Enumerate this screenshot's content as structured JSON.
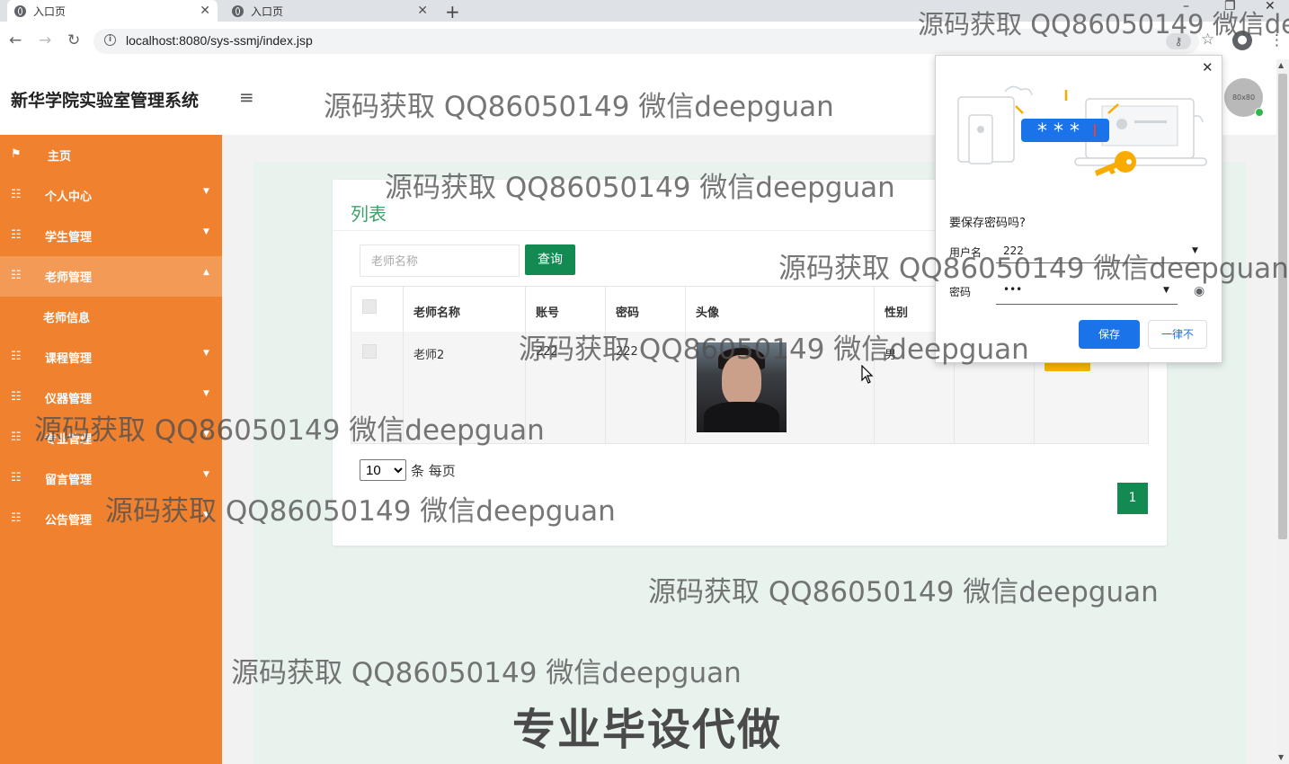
{
  "browser": {
    "tabs": [
      {
        "title": "入口页",
        "active": true
      },
      {
        "title": "入口页",
        "active": false
      }
    ],
    "new_tab": "+",
    "url": "localhost:8080/sys-ssmj/index.jsp",
    "window_controls": {
      "minimize": "–",
      "restore": "❐",
      "close": "✕"
    }
  },
  "header": {
    "title": "新华学院实验室管理系统",
    "avatar_text": "80x80"
  },
  "sidebar": {
    "items": [
      {
        "label": "主页",
        "icon": "flag-icon"
      },
      {
        "label": "个人中心",
        "icon": "grid-icon"
      },
      {
        "label": "学生管理",
        "icon": "grid-icon"
      },
      {
        "label": "老师管理",
        "icon": "grid-icon",
        "expanded": true
      },
      {
        "label": "课程管理",
        "icon": "grid-icon"
      },
      {
        "label": "仪器管理",
        "icon": "grid-icon"
      },
      {
        "label": "专业管理",
        "icon": "grid-icon"
      },
      {
        "label": "留言管理",
        "icon": "grid-icon"
      },
      {
        "label": "公告管理",
        "icon": "grid-icon"
      }
    ],
    "subitem": "老师信息"
  },
  "main": {
    "card_title": "列表",
    "search_placeholder": "老师名称",
    "query_button": "查询",
    "table": {
      "headers": [
        "老师名称",
        "账号",
        "密码",
        "头像",
        "性别"
      ],
      "rows": [
        {
          "name": "老师2",
          "account": "222",
          "password": "222",
          "gender": "男"
        }
      ]
    },
    "page_size": "10",
    "page_size_options": [
      "10"
    ],
    "per_page_label": "条 每页",
    "current_page": "1"
  },
  "password_popup": {
    "title": "要保存密码吗?",
    "username_label": "用户名",
    "username_value": "222",
    "password_label": "密码",
    "password_value": "•••",
    "save_button": "保存",
    "never_button": "一律不",
    "close": "✕",
    "illustration_text": "* * *"
  },
  "watermarks": {
    "text": "源码获取 QQ86050149 微信deepguan",
    "top_right": "源码获取 QQ86050149 微信de",
    "big": "专业毕设代做"
  },
  "colors": {
    "sidebar": "#f0812f",
    "sidebar_active": "#f39a56",
    "primary_green": "#138a52",
    "title_green": "#3aa36a",
    "chrome_blue": "#1a73e8"
  }
}
